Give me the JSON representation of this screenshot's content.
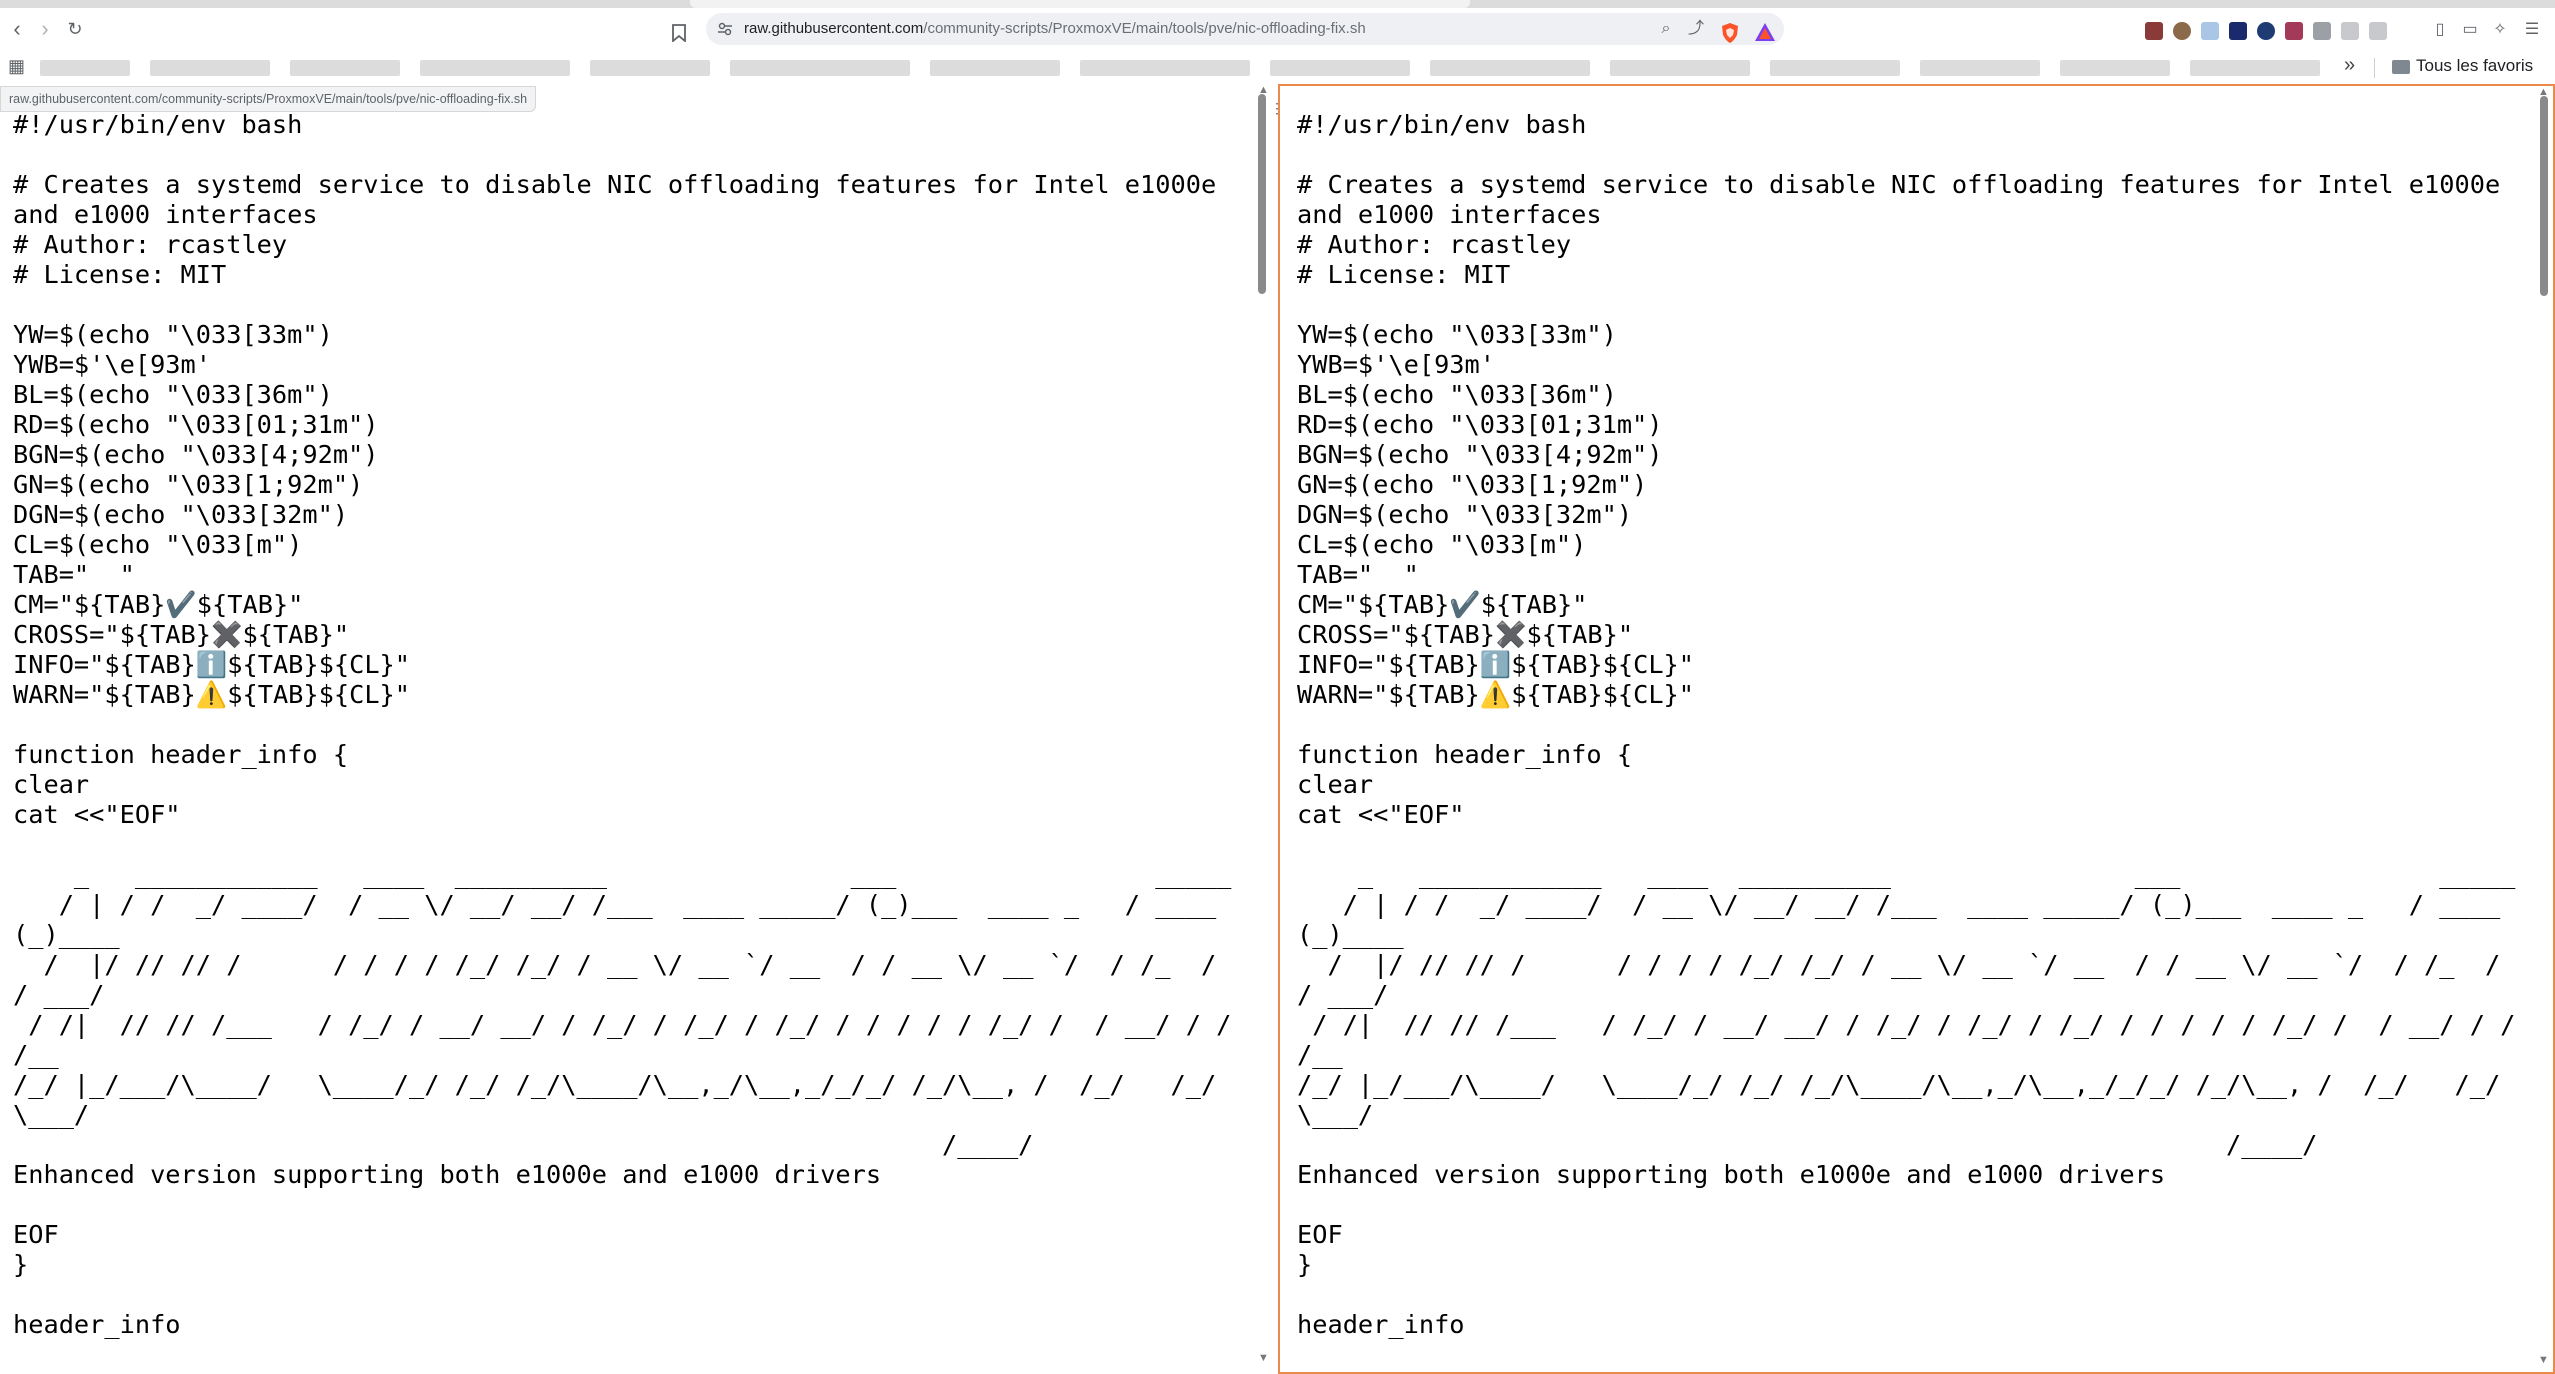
{
  "browser": {
    "url_host": "raw.githubusercontent.com",
    "url_path": "/community-scripts/ProxmoxVE/main/tools/pve/nic-offloading-fix.sh",
    "hover_url": "raw.githubusercontent.com/community-scripts/ProxmoxVE/main/tools/pve/nic-offloading-fix.sh",
    "bookmarks_folder": "Tous les favoris",
    "accent_color": "#ea8a4a"
  },
  "left_pane": {
    "code": "#!/usr/bin/env bash\n\n# Creates a systemd service to disable NIC offloading features for Intel e1000e and e1000 interfaces\n# Author: rcastley\n# License: MIT\n\nYW=$(echo \"\\033[33m\")\nYWB=$'\\e[93m'\nBL=$(echo \"\\033[36m\")\nRD=$(echo \"\\033[01;31m\")\nBGN=$(echo \"\\033[4;92m\")\nGN=$(echo \"\\033[1;92m\")\nDGN=$(echo \"\\033[32m\")\nCL=$(echo \"\\033[m\")\nTAB=\"  \"\nCM=\"${TAB}✔️${TAB}\"\nCROSS=\"${TAB}✖️${TAB}\"\nINFO=\"${TAB}ℹ️${TAB}${CL}\"\nWARN=\"${TAB}⚠️${TAB}${CL}\"\n\nfunction header_info {\nclear\ncat <<\"EOF\"\n\n    _   ____________   ____  __________                ___                 _____ \n   / | / /  _/ ____/  / __ \\/ __/ __/ /___  ____ _____/ (_)___  ____ _   / ____(_)____ \n  /  |/ // // /      / / / / /_/ /_/ / __ \\/ __ `/ __  / / __ \\/ __ `/  / /_  / / ___/ \n / /|  // // /___   / /_/ / __/ __/ / /_/ / /_/ / /_/ / / / / / /_/ /  / __/ / / /__ \n/_/ |_/___/\\____/   \\____/_/ /_/ /_/\\____/\\__,_/\\__,_/_/_/ /_/\\__, /  /_/   /_/\\___/ \n                                                             /____/ \nEnhanced version supporting both e1000e and e1000 drivers\n\nEOF\n}\n\nheader_info"
  },
  "right_pane": {
    "code": "#!/usr/bin/env bash\n\n# Creates a systemd service to disable NIC offloading features for Intel e1000e and e1000 interfaces\n# Author: rcastley\n# License: MIT\n\nYW=$(echo \"\\033[33m\")\nYWB=$'\\e[93m'\nBL=$(echo \"\\033[36m\")\nRD=$(echo \"\\033[01;31m\")\nBGN=$(echo \"\\033[4;92m\")\nGN=$(echo \"\\033[1;92m\")\nDGN=$(echo \"\\033[32m\")\nCL=$(echo \"\\033[m\")\nTAB=\"  \"\nCM=\"${TAB}✔️${TAB}\"\nCROSS=\"${TAB}✖️${TAB}\"\nINFO=\"${TAB}ℹ️${TAB}${CL}\"\nWARN=\"${TAB}⚠️${TAB}${CL}\"\n\nfunction header_info {\nclear\ncat <<\"EOF\"\n\n    _   ____________   ____  __________                ___                 _____ \n   / | / /  _/ ____/  / __ \\/ __/ __/ /___  ____ _____/ (_)___  ____ _   / ____(_)____ \n  /  |/ // // /      / / / / /_/ /_/ / __ \\/ __ `/ __  / / __ \\/ __ `/  / /_  / / ___/ \n / /|  // // /___   / /_/ / __/ __/ / /_/ / /_/ / /_/ / / / / / /_/ /  / __/ / / /__ \n/_/ |_/___/\\____/   \\____/_/ /_/ /_/\\____/\\__,_/\\__,_/_/_/ /_/\\__, /  /_/   /_/\\___/ \n                                                             /____/ \nEnhanced version supporting both e1000e and e1000 drivers\n\nEOF\n}\n\nheader_info"
  }
}
